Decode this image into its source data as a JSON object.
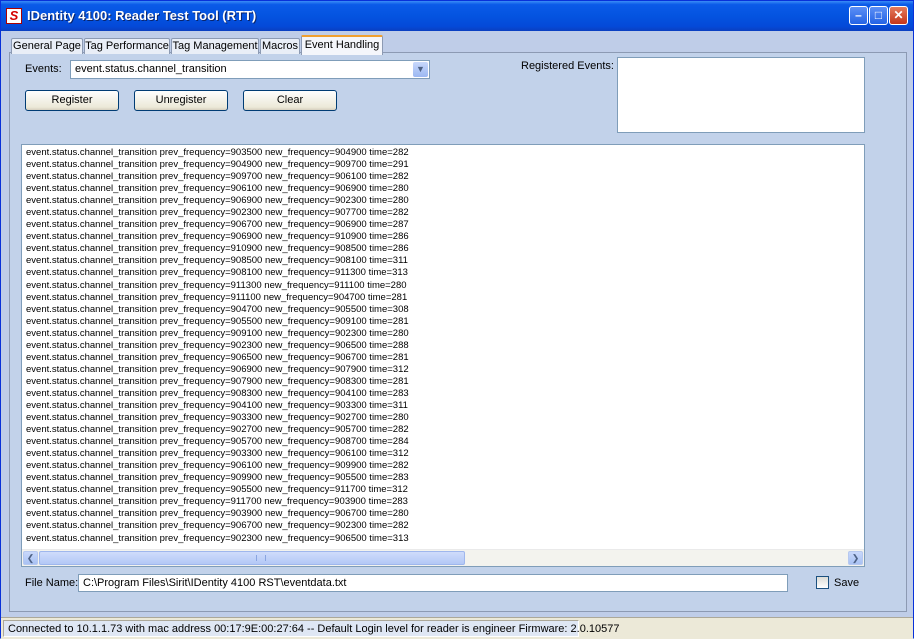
{
  "window": {
    "title": "IDentity 4100: Reader Test Tool (RTT)",
    "app_icon_letter": "S",
    "minimize_glyph": "–",
    "maximize_glyph": "□",
    "close_glyph": "✕"
  },
  "tabs": [
    {
      "label": "General Page",
      "active": false
    },
    {
      "label": "Tag Performance",
      "active": false
    },
    {
      "label": "Tag Management",
      "active": false
    },
    {
      "label": "Macros",
      "active": false
    },
    {
      "label": "Event Handling",
      "active": true
    }
  ],
  "events": {
    "label": "Events:",
    "selected": "event.status.channel_transition",
    "arrow_glyph": "▼"
  },
  "buttons": {
    "register": "Register",
    "unregister": "Unregister",
    "clear": "Clear"
  },
  "registered_events": {
    "label": "Registered Events:",
    "items": []
  },
  "log": {
    "lines": [
      "event.status.channel_transition prev_frequency=903500 new_frequency=904900 time=282",
      "event.status.channel_transition prev_frequency=904900 new_frequency=909700 time=291",
      "event.status.channel_transition prev_frequency=909700 new_frequency=906100 time=282",
      "event.status.channel_transition prev_frequency=906100 new_frequency=906900 time=280",
      "event.status.channel_transition prev_frequency=906900 new_frequency=902300 time=280",
      "event.status.channel_transition prev_frequency=902300 new_frequency=907700 time=282",
      "event.status.channel_transition prev_frequency=906700 new_frequency=906900 time=287",
      "event.status.channel_transition prev_frequency=906900 new_frequency=910900 time=286",
      "event.status.channel_transition prev_frequency=910900 new_frequency=908500 time=286",
      "event.status.channel_transition prev_frequency=908500 new_frequency=908100 time=311",
      "event.status.channel_transition prev_frequency=908100 new_frequency=911300 time=313",
      "event.status.channel_transition prev_frequency=911300 new_frequency=911100 time=280",
      "event.status.channel_transition prev_frequency=911100 new_frequency=904700 time=281",
      "event.status.channel_transition prev_frequency=904700 new_frequency=905500 time=308",
      "event.status.channel_transition prev_frequency=905500 new_frequency=909100 time=281",
      "event.status.channel_transition prev_frequency=909100 new_frequency=902300 time=280",
      "event.status.channel_transition prev_frequency=902300 new_frequency=906500 time=288",
      "event.status.channel_transition prev_frequency=906500 new_frequency=906700 time=281",
      "event.status.channel_transition prev_frequency=906900 new_frequency=907900 time=312",
      "event.status.channel_transition prev_frequency=907900 new_frequency=908300 time=281",
      "event.status.channel_transition prev_frequency=908300 new_frequency=904100 time=283",
      "event.status.channel_transition prev_frequency=904100 new_frequency=903300 time=311",
      "event.status.channel_transition prev_frequency=903300 new_frequency=902700 time=280",
      "event.status.channel_transition prev_frequency=902700 new_frequency=905700 time=282",
      "event.status.channel_transition prev_frequency=905700 new_frequency=908700 time=284",
      "event.status.channel_transition prev_frequency=903300 new_frequency=906100 time=312",
      "event.status.channel_transition prev_frequency=906100 new_frequency=909900 time=282",
      "event.status.channel_transition prev_frequency=909900 new_frequency=905500 time=283",
      "event.status.channel_transition prev_frequency=905500 new_frequency=911700 time=312",
      "event.status.channel_transition prev_frequency=911700 new_frequency=903900 time=283",
      "event.status.channel_transition prev_frequency=903900 new_frequency=906700 time=280",
      "event.status.channel_transition prev_frequency=906700 new_frequency=902300 time=282",
      "event.status.channel_transition prev_frequency=902300 new_frequency=906500 time=313"
    ],
    "scroll_left_glyph": "❮",
    "scroll_right_glyph": "❯"
  },
  "file": {
    "label": "File Name:",
    "value": "C:\\Program Files\\Sirit\\IDentity 4100 RST\\eventdata.txt",
    "save_label": "Save",
    "save_checked": false
  },
  "status_bar": {
    "text": "Connected to 10.1.1.73 with mac address 00:17:9E:00:27:64 -- Default Login level for reader is engineer   Firmware: 2.0.10577"
  }
}
